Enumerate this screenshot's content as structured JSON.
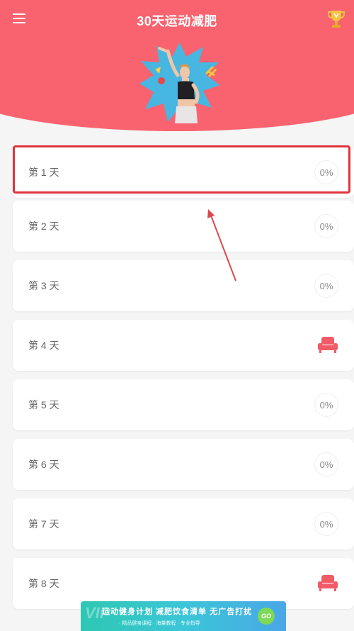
{
  "header": {
    "title": "30天运动减肥",
    "menu_icon": "hamburger-menu-icon",
    "trophy_icon": "trophy-icon"
  },
  "colors": {
    "brand": "#f8636f",
    "highlight": "#e0353a",
    "rest_icon": "#f15b67"
  },
  "days": [
    {
      "label": "第 1 天",
      "status": "progress",
      "progress": "0%"
    },
    {
      "label": "第 2 天",
      "status": "progress",
      "progress": "0%"
    },
    {
      "label": "第 3 天",
      "status": "progress",
      "progress": "0%"
    },
    {
      "label": "第 4 天",
      "status": "rest",
      "icon": "sofa-icon"
    },
    {
      "label": "第 5 天",
      "status": "progress",
      "progress": "0%"
    },
    {
      "label": "第 6 天",
      "status": "progress",
      "progress": "0%"
    },
    {
      "label": "第 7 天",
      "status": "progress",
      "progress": "0%"
    },
    {
      "label": "第 8 天",
      "status": "rest",
      "icon": "sofa-icon"
    }
  ],
  "ad": {
    "vip": "VIP",
    "text": "运动健身计划 减肥饮食清单 无广告打扰",
    "sub": "· 精品健身课程  · 海量教程  · 专业指导",
    "go": "GO"
  }
}
